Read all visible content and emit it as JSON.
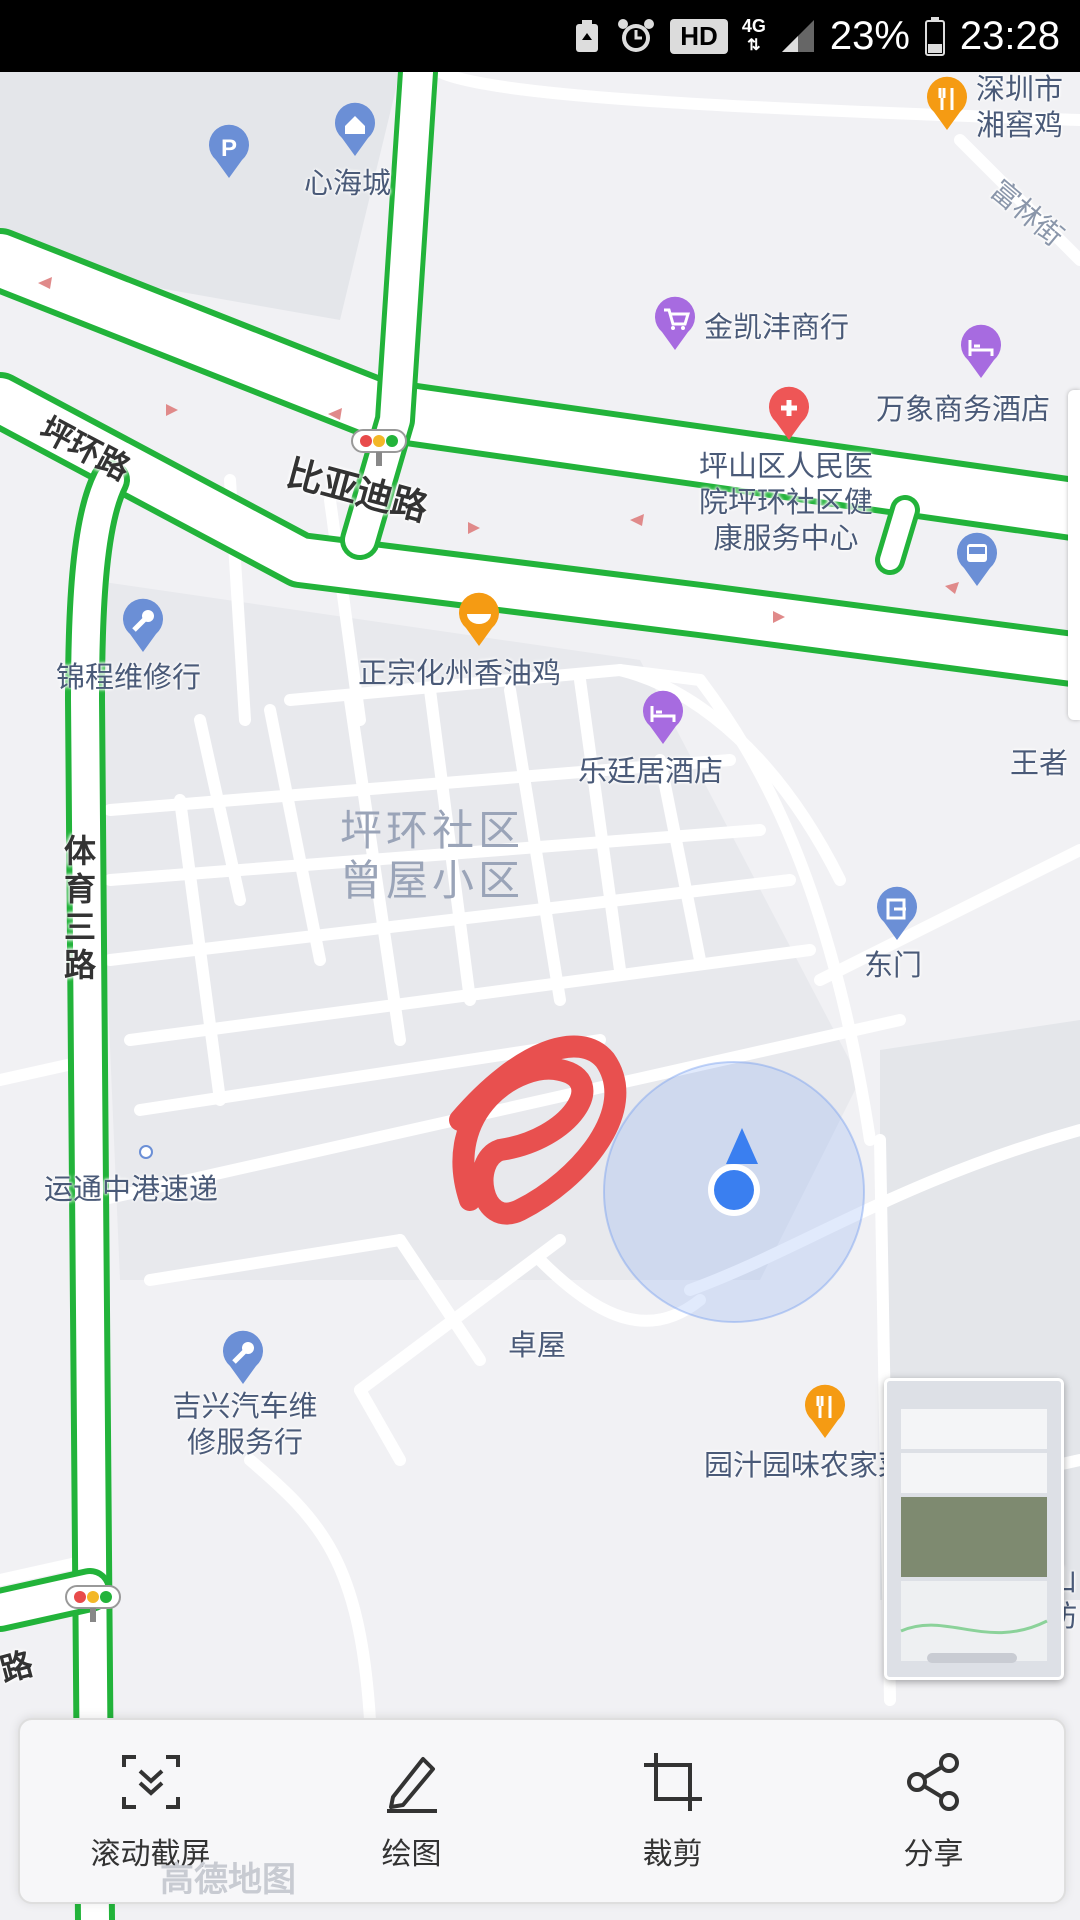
{
  "status_bar": {
    "network": "4G",
    "hd_badge": "HD",
    "battery_percent": "23%",
    "time": "23:28",
    "icons": [
      "recycle-icon",
      "alarm-icon",
      "signal-icon",
      "battery-icon"
    ]
  },
  "map": {
    "roads": {
      "biyadi": "比亚迪路",
      "pinghuan": "坪环路",
      "tiyu": "体育三路",
      "fulin": "富林街",
      "bottom_road": "路"
    },
    "area": {
      "line1": "坪环社区",
      "line2": "曾屋小区"
    },
    "pois": {
      "xinhaicheng": "心海城",
      "shenzhen_top": "深圳市",
      "xiangyao": "湘窖鸡",
      "jinkai": "金凯沣商行",
      "wanxiang": "万象商务酒店",
      "hospital_l1": "坪山区人民医",
      "hospital_l2": "院坪环社区健",
      "hospital_l3": "康服务中心",
      "jincheng": "锦程维修行",
      "xiangyouji": "正宗化州香油鸡",
      "leting": "乐廷居酒店",
      "wangzhe": "王者",
      "dongmen": "东门",
      "yuntong": "运通中港速递",
      "zhuowu": "卓屋",
      "jixing_l1": "吉兴汽车维",
      "jixing_l2": "修服务行",
      "yuanzhi": "园汁园味农家菜",
      "pingshan_edge_l1": "坪山",
      "pingshan_edge_l2": "展坊"
    },
    "watermark": "高德地图"
  },
  "toolbar": {
    "scroll_capture": "滚动截屏",
    "draw": "绘图",
    "crop": "裁剪",
    "share": "分享"
  },
  "colors": {
    "road_traffic_green": "#22b33a",
    "location_blue": "#3a7ff0",
    "annotation_red": "#e8504f",
    "poi_blue": "#6b8fd6",
    "poi_orange": "#f59b13",
    "poi_purple": "#a76be0",
    "poi_red": "#ee5656"
  }
}
